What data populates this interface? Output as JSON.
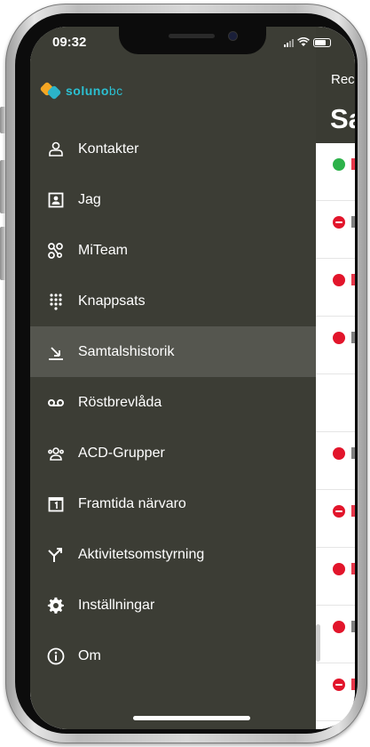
{
  "status_bar": {
    "time": "09:32"
  },
  "brand": {
    "logo_text_bold": "soluno",
    "logo_text_light": "bc",
    "logo_colors": [
      "#f5a623",
      "#2bb3c9"
    ]
  },
  "background_page": {
    "back_label": "Rec",
    "title_partial": "Sa"
  },
  "menu": {
    "items": [
      {
        "label": "Kontakter",
        "icon": "contacts-icon",
        "active": false
      },
      {
        "label": "Jag",
        "icon": "profile-card-icon",
        "active": false
      },
      {
        "label": "MiTeam",
        "icon": "team-icon",
        "active": false
      },
      {
        "label": "Knappsats",
        "icon": "keypad-icon",
        "active": false
      },
      {
        "label": "Samtalshistorik",
        "icon": "call-history-icon",
        "active": true
      },
      {
        "label": "Röstbrevlåda",
        "icon": "voicemail-icon",
        "active": false
      },
      {
        "label": "ACD-Grupper",
        "icon": "acd-groups-icon",
        "active": false
      },
      {
        "label": "Framtida närvaro",
        "icon": "calendar-icon",
        "active": false
      },
      {
        "label": "Aktivitetsomstyrning",
        "icon": "redirect-icon",
        "active": false
      },
      {
        "label": "Inställningar",
        "icon": "settings-gear-icon",
        "active": false
      },
      {
        "label": "Om",
        "icon": "info-icon",
        "active": false
      }
    ]
  },
  "colors": {
    "drawer_bg": "#3c3d35",
    "active_item_bg": "#55564f",
    "missed_call": "#e2152b",
    "online_green": "#2db24a",
    "logo_teal": "#2bc0d2"
  }
}
